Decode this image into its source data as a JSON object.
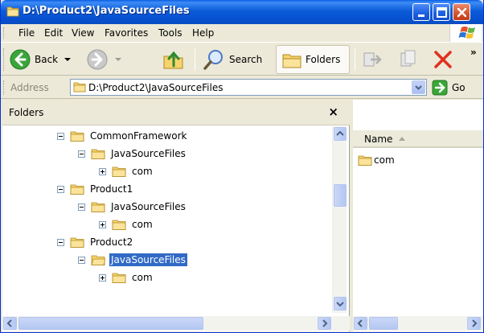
{
  "window": {
    "title": "D:\\Product2\\JavaSourceFiles"
  },
  "menu": {
    "items": [
      {
        "label": "File"
      },
      {
        "label": "Edit"
      },
      {
        "label": "View"
      },
      {
        "label": "Favorites"
      },
      {
        "label": "Tools"
      },
      {
        "label": "Help"
      }
    ]
  },
  "toolbar": {
    "back_label": "Back",
    "search_label": "Search",
    "folders_label": "Folders",
    "overflow": "»"
  },
  "address": {
    "label": "Address",
    "value": "D:\\Product2\\JavaSourceFiles",
    "go_label": "Go"
  },
  "folders_pane": {
    "title": "Folders",
    "close_glyph": "×",
    "tree": [
      {
        "label": "CommonFramework",
        "expanded": true
      },
      {
        "label": "JavaSourceFiles",
        "expanded": true
      },
      {
        "label": "com",
        "expanded": false
      },
      {
        "label": "Product1",
        "expanded": true
      },
      {
        "label": "JavaSourceFiles",
        "expanded": true
      },
      {
        "label": "com",
        "expanded": false
      },
      {
        "label": "Product2",
        "expanded": true
      },
      {
        "label": "JavaSourceFiles",
        "expanded": true,
        "selected": true
      },
      {
        "label": "com",
        "expanded": false
      }
    ]
  },
  "file_list": {
    "column_name": "Name",
    "items": [
      {
        "name": "com"
      }
    ]
  },
  "colors": {
    "titlebar": "#0b5bd8",
    "selection": "#316ac5",
    "folder": "#f6d36b",
    "close": "#d4532e"
  }
}
